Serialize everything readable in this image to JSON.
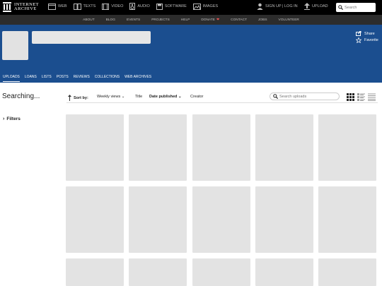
{
  "topbar": {
    "logo_line1": "INTERNET",
    "logo_line2": "ARCHIVE",
    "media": [
      {
        "label": "WEB",
        "icon": "web-icon"
      },
      {
        "label": "TEXTS",
        "icon": "book-icon"
      },
      {
        "label": "VIDEO",
        "icon": "film-icon"
      },
      {
        "label": "AUDIO",
        "icon": "speaker-icon"
      },
      {
        "label": "SOFTWARE",
        "icon": "floppy-icon"
      },
      {
        "label": "IMAGES",
        "icon": "image-icon"
      }
    ],
    "auth_label": "SIGN UP | LOG IN",
    "upload_label": "UPLOAD",
    "search_placeholder": "Search"
  },
  "subnav": {
    "items": [
      "ABOUT",
      "BLOG",
      "EVENTS",
      "PROJECTS",
      "HELP",
      "DONATE",
      "CONTACT",
      "JOBS",
      "VOLUNTEER"
    ]
  },
  "banner": {
    "share_label": "Share",
    "favorite_label": "Favorite",
    "tabs": [
      "UPLOADS",
      "LOANS",
      "LISTS",
      "POSTS",
      "REVIEWS",
      "COLLECTIONS",
      "WEB ARCHIVES"
    ],
    "active_tab": "UPLOADS"
  },
  "sidebar": {
    "status": "Searching...",
    "filters_label": "Filters"
  },
  "sortbar": {
    "label": "Sort by:",
    "options": [
      "Weekly views",
      "Title",
      "Date published",
      "Creator"
    ],
    "search_placeholder": "Search uploads"
  },
  "colors": {
    "banner": "#1b4e8f",
    "topbar": "#000000",
    "subnav": "#2c2c2c",
    "tile": "#e3e3e3"
  }
}
